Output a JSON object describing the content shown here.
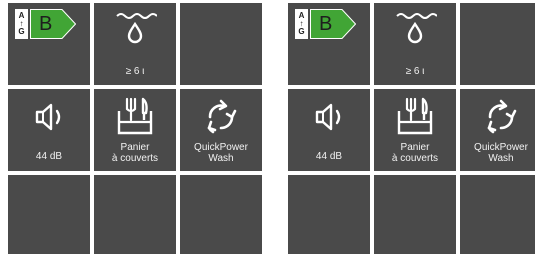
{
  "panels": [
    {
      "energy": {
        "scale_top": "A",
        "scale_bottom": "G",
        "class": "B",
        "class_color": "#41a535"
      },
      "water": {
        "label": "≥ 6 ι"
      },
      "noise": {
        "label": "44 dB"
      },
      "cutlery": {
        "line1": "Panier",
        "line2": "à couverts"
      },
      "quickpower": {
        "line1": "QuickPower",
        "line2": "Wash"
      }
    },
    {
      "energy": {
        "scale_top": "A",
        "scale_bottom": "G",
        "class": "B",
        "class_color": "#41a535"
      },
      "water": {
        "label": "≥ 6 ι"
      },
      "noise": {
        "label": "44 dB"
      },
      "cutlery": {
        "line1": "Panier",
        "line2": "à couverts"
      },
      "quickpower": {
        "line1": "QuickPower",
        "line2": "Wash"
      }
    }
  ],
  "colors": {
    "tile": "#4a4a4a",
    "background": "#ffffff",
    "energy_green": "#41a535"
  }
}
